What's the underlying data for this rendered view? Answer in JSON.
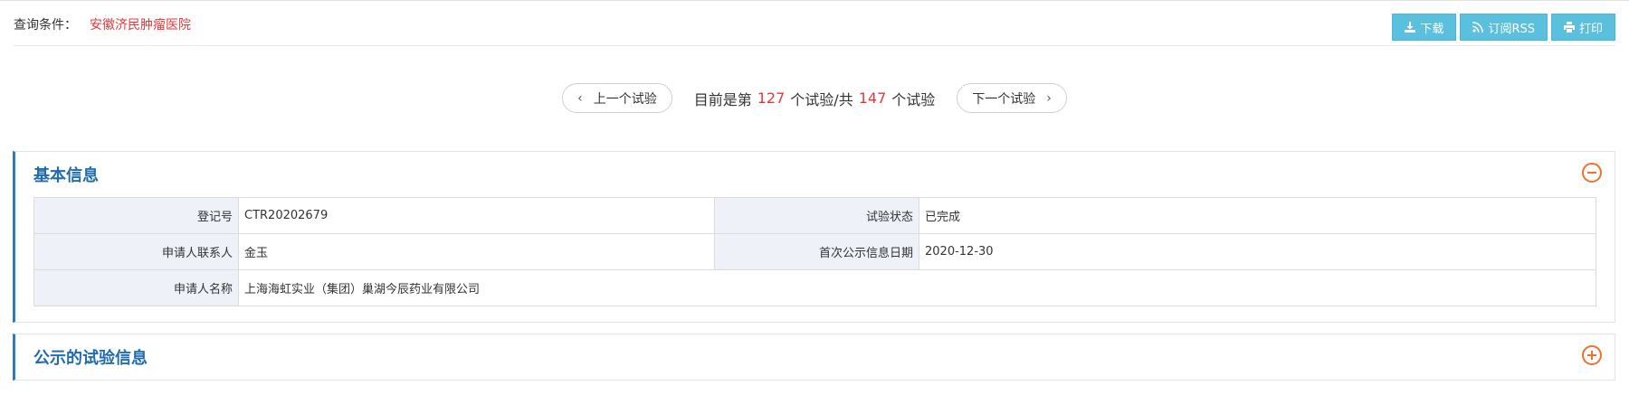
{
  "query": {
    "label": "查询条件：",
    "value": "安徽济民肿瘤医院"
  },
  "actions": [
    {
      "label": "下载",
      "icon": "download-icon"
    },
    {
      "label": "订阅RSS",
      "icon": "rss-icon"
    },
    {
      "label": "打印",
      "icon": "print-icon"
    }
  ],
  "pager": {
    "prev_label": "上一个试验",
    "next_label": "下一个试验",
    "text_before": "目前是第",
    "current": "127",
    "text_middle": "个试验/共",
    "total": "147",
    "text_after": "个试验"
  },
  "basic_info": {
    "title": "基本信息",
    "rows": [
      {
        "label1": "登记号",
        "value1": "CTR20202679",
        "label2": "试验状态",
        "value2": "已完成"
      },
      {
        "label1": "申请人联系人",
        "value1": "金玉",
        "label2": "首次公示信息日期",
        "value2": "2020-12-30"
      },
      {
        "label1": "申请人名称",
        "value1": "上海海虹实业（集团）巢湖今辰药业有限公司"
      }
    ]
  },
  "public_info": {
    "title": "公示的试验信息"
  },
  "colors": {
    "accent": "#1f6cb1",
    "highlight": "#e4393c",
    "button": "#5bc0de",
    "toggle": "#f0712c"
  }
}
